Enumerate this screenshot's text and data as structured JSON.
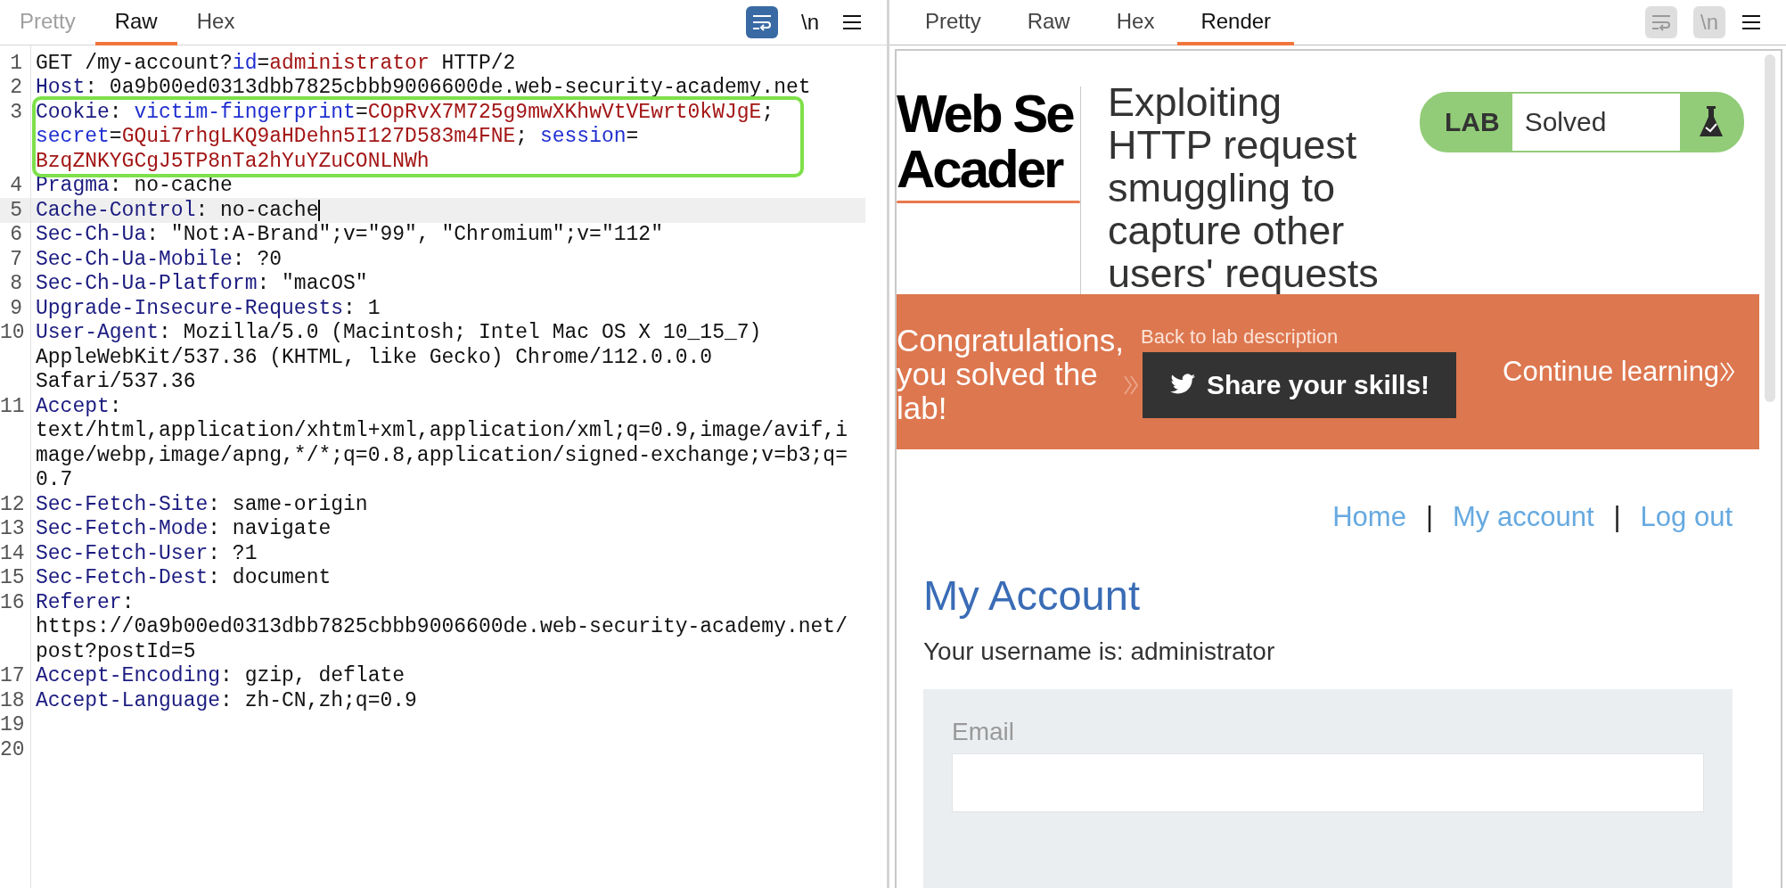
{
  "request_pane": {
    "tabs": [
      {
        "label": "Pretty",
        "selected": false,
        "disabled": true
      },
      {
        "label": "Raw",
        "selected": true,
        "disabled": false
      },
      {
        "label": "Hex",
        "selected": false,
        "disabled": false
      }
    ],
    "toolbar": {
      "wrap_active": true,
      "newline_label": "\\n"
    },
    "lines": [
      {
        "number": "1",
        "current": false,
        "outlined": false,
        "rows": [
          {
            "parts": [
              {
                "kind": "plain",
                "text": "GET /my-account?"
              },
              {
                "kind": "param",
                "text": "id"
              },
              {
                "kind": "plain",
                "text": "="
              },
              {
                "kind": "value",
                "text": "administrator"
              },
              {
                "kind": "plain",
                "text": " HTTP/2"
              }
            ]
          }
        ]
      },
      {
        "number": "2",
        "current": false,
        "outlined": false,
        "rows": [
          {
            "parts": [
              {
                "kind": "header",
                "text": "Host"
              },
              {
                "kind": "plain",
                "text": ": 0a9b00ed0313dbb7825cbbb9006600de.web-security-academy.net"
              }
            ]
          }
        ]
      },
      {
        "number": "3",
        "current": false,
        "outlined": true,
        "rows": [
          {
            "parts": [
              {
                "kind": "header",
                "text": "Cookie"
              },
              {
                "kind": "plain",
                "text": ": "
              },
              {
                "kind": "param",
                "text": "victim-fingerprint"
              },
              {
                "kind": "plain",
                "text": "="
              },
              {
                "kind": "value",
                "text": "COpRvX7M725g9mwXKhwVtVEwrt0kWJgE"
              },
              {
                "kind": "plain",
                "text": ";"
              }
            ]
          },
          {
            "parts": [
              {
                "kind": "param",
                "text": "secret"
              },
              {
                "kind": "plain",
                "text": "="
              },
              {
                "kind": "value",
                "text": "GQui7rhgLKQ9aHDehn5I127D583m4FNE"
              },
              {
                "kind": "plain",
                "text": "; "
              },
              {
                "kind": "param",
                "text": "session"
              },
              {
                "kind": "plain",
                "text": "="
              }
            ]
          },
          {
            "parts": [
              {
                "kind": "value",
                "text": "BzqZNKYGCgJ5TP8nTa2hYuYZuCONLNWh"
              }
            ]
          }
        ]
      },
      {
        "number": "4",
        "current": false,
        "outlined": false,
        "rows": [
          {
            "parts": [
              {
                "kind": "header",
                "text": "Pragma"
              },
              {
                "kind": "plain",
                "text": ": no-cache"
              }
            ]
          }
        ]
      },
      {
        "number": "5",
        "current": true,
        "outlined": false,
        "rows": [
          {
            "parts": [
              {
                "kind": "header",
                "text": "Cache-Control"
              },
              {
                "kind": "plain",
                "text": ": no-cache"
              }
            ]
          }
        ]
      },
      {
        "number": "6",
        "current": false,
        "outlined": false,
        "rows": [
          {
            "parts": [
              {
                "kind": "header",
                "text": "Sec-Ch-Ua"
              },
              {
                "kind": "plain",
                "text": ": \"Not:A-Brand\";v=\"99\", \"Chromium\";v=\"112\""
              }
            ]
          }
        ]
      },
      {
        "number": "7",
        "current": false,
        "outlined": false,
        "rows": [
          {
            "parts": [
              {
                "kind": "header",
                "text": "Sec-Ch-Ua-Mobile"
              },
              {
                "kind": "plain",
                "text": ": ?0"
              }
            ]
          }
        ]
      },
      {
        "number": "8",
        "current": false,
        "outlined": false,
        "rows": [
          {
            "parts": [
              {
                "kind": "header",
                "text": "Sec-Ch-Ua-Platform"
              },
              {
                "kind": "plain",
                "text": ": \"macOS\""
              }
            ]
          }
        ]
      },
      {
        "number": "9",
        "current": false,
        "outlined": false,
        "rows": [
          {
            "parts": [
              {
                "kind": "header",
                "text": "Upgrade-Insecure-Requests"
              },
              {
                "kind": "plain",
                "text": ": 1"
              }
            ]
          }
        ]
      },
      {
        "number": "10",
        "current": false,
        "outlined": false,
        "rows": [
          {
            "parts": [
              {
                "kind": "header",
                "text": "User-Agent"
              },
              {
                "kind": "plain",
                "text": ": Mozilla/5.0 (Macintosh; Intel Mac OS X 10_15_7)"
              }
            ]
          },
          {
            "parts": [
              {
                "kind": "plain",
                "text": "AppleWebKit/537.36 (KHTML, like Gecko) Chrome/112.0.0.0"
              }
            ]
          },
          {
            "parts": [
              {
                "kind": "plain",
                "text": "Safari/537.36"
              }
            ]
          }
        ]
      },
      {
        "number": "11",
        "current": false,
        "outlined": false,
        "rows": [
          {
            "parts": [
              {
                "kind": "header",
                "text": "Accept"
              },
              {
                "kind": "plain",
                "text": ":"
              }
            ]
          },
          {
            "parts": [
              {
                "kind": "plain",
                "text": "text/html,application/xhtml+xml,application/xml;q=0.9,image/avif,i"
              }
            ]
          },
          {
            "parts": [
              {
                "kind": "plain",
                "text": "mage/webp,image/apng,*/*;q=0.8,application/signed-exchange;v=b3;q="
              }
            ]
          },
          {
            "parts": [
              {
                "kind": "plain",
                "text": "0.7"
              }
            ]
          }
        ]
      },
      {
        "number": "12",
        "current": false,
        "outlined": false,
        "rows": [
          {
            "parts": [
              {
                "kind": "header",
                "text": "Sec-Fetch-Site"
              },
              {
                "kind": "plain",
                "text": ": same-origin"
              }
            ]
          }
        ]
      },
      {
        "number": "13",
        "current": false,
        "outlined": false,
        "rows": [
          {
            "parts": [
              {
                "kind": "header",
                "text": "Sec-Fetch-Mode"
              },
              {
                "kind": "plain",
                "text": ": navigate"
              }
            ]
          }
        ]
      },
      {
        "number": "14",
        "current": false,
        "outlined": false,
        "rows": [
          {
            "parts": [
              {
                "kind": "header",
                "text": "Sec-Fetch-User"
              },
              {
                "kind": "plain",
                "text": ": ?1"
              }
            ]
          }
        ]
      },
      {
        "number": "15",
        "current": false,
        "outlined": false,
        "rows": [
          {
            "parts": [
              {
                "kind": "header",
                "text": "Sec-Fetch-Dest"
              },
              {
                "kind": "plain",
                "text": ": document"
              }
            ]
          }
        ]
      },
      {
        "number": "16",
        "current": false,
        "outlined": false,
        "rows": [
          {
            "parts": [
              {
                "kind": "header",
                "text": "Referer"
              },
              {
                "kind": "plain",
                "text": ":"
              }
            ]
          },
          {
            "parts": [
              {
                "kind": "plain",
                "text": "https://0a9b00ed0313dbb7825cbbb9006600de.web-security-academy.net/"
              }
            ]
          },
          {
            "parts": [
              {
                "kind": "plain",
                "text": "post?postId=5"
              }
            ]
          }
        ]
      },
      {
        "number": "17",
        "current": false,
        "outlined": false,
        "rows": [
          {
            "parts": [
              {
                "kind": "header",
                "text": "Accept-Encoding"
              },
              {
                "kind": "plain",
                "text": ": gzip, deflate"
              }
            ]
          }
        ]
      },
      {
        "number": "18",
        "current": false,
        "outlined": false,
        "rows": [
          {
            "parts": [
              {
                "kind": "header",
                "text": "Accept-Language"
              },
              {
                "kind": "plain",
                "text": ": zh-CN,zh;q=0.9"
              }
            ]
          }
        ]
      },
      {
        "number": "19",
        "current": false,
        "outlined": false
      },
      {
        "number": "20",
        "current": false,
        "outlined": false
      }
    ]
  },
  "response_pane": {
    "tabs": [
      {
        "label": "Pretty",
        "selected": false,
        "disabled": false
      },
      {
        "label": "Raw",
        "selected": false,
        "disabled": false
      },
      {
        "label": "Hex",
        "selected": false,
        "disabled": false
      },
      {
        "label": "Render",
        "selected": true,
        "disabled": false
      }
    ],
    "toolbar": {
      "wrap_active": false,
      "newline_label": "\\n"
    },
    "render": {
      "logo": [
        "Web Se",
        "Acader"
      ],
      "lab_title": "Exploiting HTTP request smuggling to capture other users' requests",
      "lab_badge": {
        "label": "LAB",
        "status": "Solved"
      },
      "banner": {
        "message": "Congratulations, you solved the lab!",
        "back_link": "Back to lab description",
        "share_button": "Share your skills!",
        "continue_link": "Continue learning"
      },
      "nav": [
        {
          "kind": "link",
          "text": "Home"
        },
        {
          "kind": "separator",
          "text": "|"
        },
        {
          "kind": "link",
          "text": "My account"
        },
        {
          "kind": "separator",
          "text": "|"
        },
        {
          "kind": "link",
          "text": "Log out"
        }
      ],
      "heading": "My Account",
      "username_text": "Your username is: administrator",
      "form": {
        "email_label": "Email"
      }
    }
  }
}
